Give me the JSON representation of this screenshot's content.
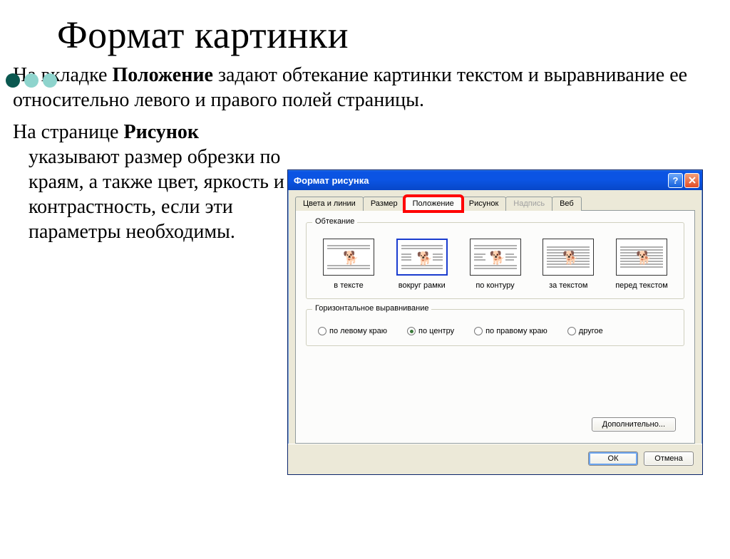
{
  "slide": {
    "title": "Формат картинки",
    "para1_pre": "На вкладке ",
    "para1_bold": "Положение",
    "para1_post": " задают обтекание картинки текстом и выравнивание ее относительно левого и правого полей страницы.",
    "para2_pre": "На странице ",
    "para2_bold": "Рисунок",
    "para2_post": " указывают размер обрезки по краям, а также цвет, яркость и контрастность, если эти параметры необходимы."
  },
  "dialog": {
    "title": "Формат рисунка",
    "tabs": {
      "colors": "Цвета и линии",
      "size": "Размер",
      "position": "Положение",
      "picture": "Рисунок",
      "textbox": "Надпись",
      "web": "Веб"
    },
    "groups": {
      "wrap": "Обтекание",
      "halign": "Горизонтальное выравнивание"
    },
    "wrap_options": {
      "inline": "в тексте",
      "square": "вокруг рамки",
      "tight": "по контуру",
      "behind": "за текстом",
      "front": "перед текстом"
    },
    "align_options": {
      "left": "по левому краю",
      "center": "по центру",
      "right": "по правому краю",
      "other": "другое"
    },
    "buttons": {
      "advanced": "Дополнительно...",
      "ok": "ОК",
      "cancel": "Отмена"
    }
  }
}
